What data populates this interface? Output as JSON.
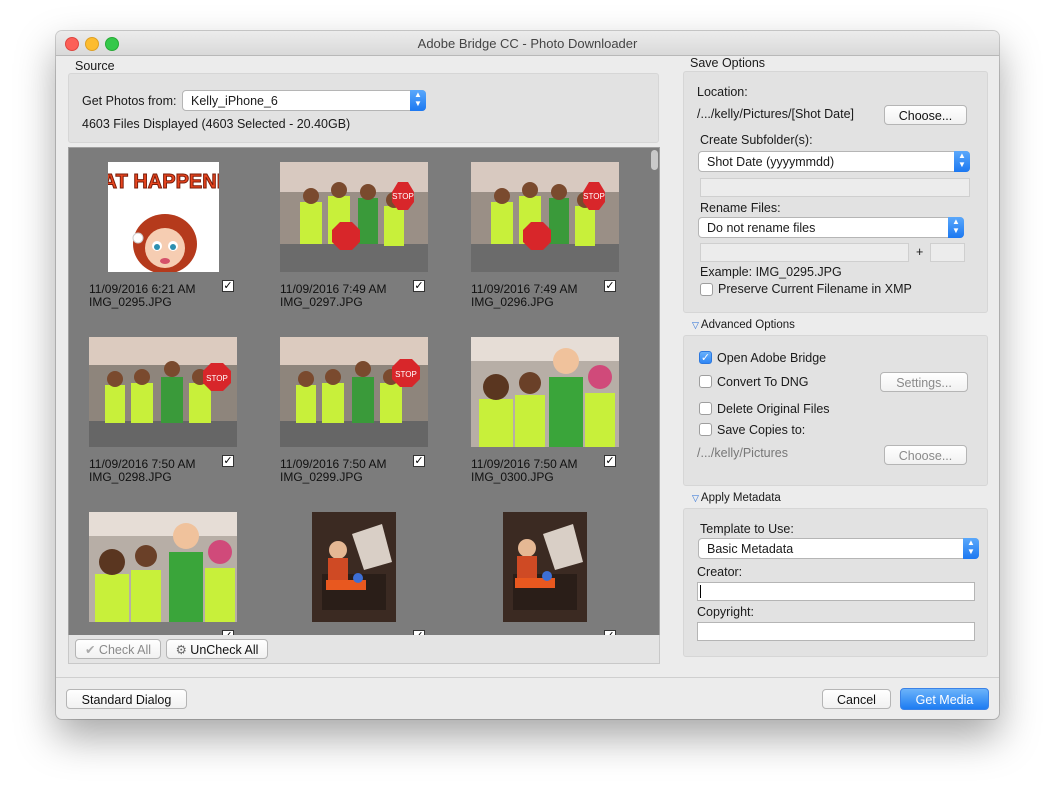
{
  "window": {
    "title": "Adobe Bridge CC - Photo Downloader"
  },
  "source": {
    "heading": "Source",
    "get_photos_label": "Get Photos from:",
    "device": "Kelly_iPhone_6",
    "files_displayed": "4603 Files Displayed (4603 Selected - 20.40GB)"
  },
  "thumbnails": [
    {
      "date": "11/09/2016 6:21 AM",
      "name": "IMG_0295.JPG",
      "checked": true
    },
    {
      "date": "11/09/2016 7:49 AM",
      "name": "IMG_0297.JPG",
      "checked": true
    },
    {
      "date": "11/09/2016 7:49 AM",
      "name": "IMG_0296.JPG",
      "checked": true
    },
    {
      "date": "11/09/2016 7:50 AM",
      "name": "IMG_0298.JPG",
      "checked": true
    },
    {
      "date": "11/09/2016 7:50 AM",
      "name": "IMG_0299.JPG",
      "checked": true
    },
    {
      "date": "11/09/2016 7:50 AM",
      "name": "IMG_0300.JPG",
      "checked": true
    }
  ],
  "thumb_art": {
    "what_happened": "WHAT HAPPENED?",
    "stop": "STOP"
  },
  "grid_buttons": {
    "check_all": "Check All",
    "uncheck_all": "UnCheck All"
  },
  "save_options": {
    "heading": "Save Options",
    "location_label": "Location:",
    "location_path": "/.../kelly/Pictures/[Shot Date]",
    "choose": "Choose...",
    "subfolder_label": "Create Subfolder(s):",
    "subfolder_value": "Shot Date (yyyymmdd)",
    "rename_label": "Rename Files:",
    "rename_value": "Do not rename files",
    "plus": "+",
    "example": "Example:  IMG_0295.JPG",
    "preserve": "Preserve Current Filename in XMP"
  },
  "advanced": {
    "heading": "Advanced Options",
    "open_bridge": "Open Adobe Bridge",
    "convert_dng": "Convert To DNG",
    "settings": "Settings...",
    "delete_originals": "Delete Original Files",
    "save_copies": "Save Copies to:",
    "copies_path": "/.../kelly/Pictures",
    "choose": "Choose..."
  },
  "metadata": {
    "heading": "Apply Metadata",
    "template_label": "Template to Use:",
    "template_value": "Basic Metadata",
    "creator_label": "Creator:",
    "copyright_label": "Copyright:"
  },
  "footer": {
    "standard_dialog": "Standard Dialog",
    "cancel": "Cancel",
    "get_media": "Get Media"
  },
  "colors": {
    "accent": "#1d7cf2",
    "grid_bg": "#7c7c7c",
    "vest": "#c8f03a"
  }
}
